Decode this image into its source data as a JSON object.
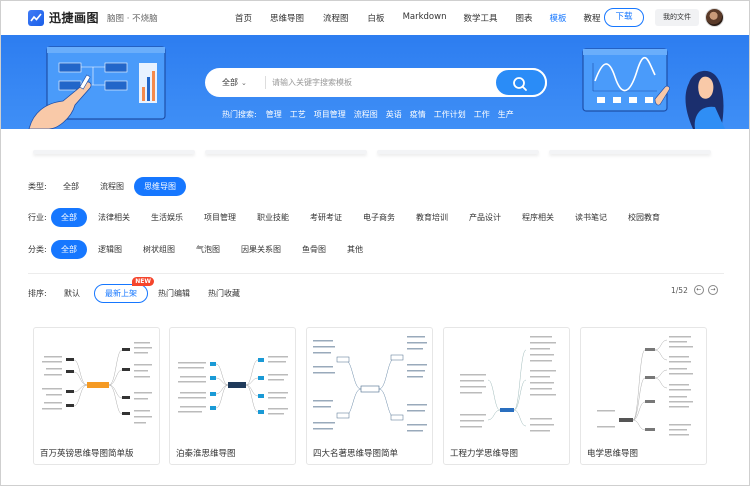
{
  "header": {
    "logo_text": "迅捷画图",
    "logo_sub": "脑图 · 不烧脑",
    "nav": [
      "首页",
      "思维导图",
      "流程图",
      "白板",
      "Markdown",
      "数学工具",
      "图表",
      "模板",
      "教程"
    ],
    "nav_active": "模板",
    "download_label": "下载",
    "my_files_label": "我的文件",
    "accent_color": "#1677ff"
  },
  "search": {
    "category": "全部",
    "placeholder": "请输入关键字搜索模板",
    "hot_label": "热门搜索:",
    "hot_terms": [
      "管理",
      "工艺",
      "项目管理",
      "流程图",
      "英语",
      "疫情",
      "工作计划",
      "工作",
      "生产"
    ]
  },
  "filters": {
    "type": {
      "label": "类型:",
      "options": [
        "全部",
        "流程图",
        "思维导图"
      ],
      "selected": "思维导图"
    },
    "industry": {
      "label": "行业:",
      "options": [
        "全部",
        "法律相关",
        "生活娱乐",
        "项目管理",
        "职业技能",
        "考研考证",
        "电子商务",
        "教育培训",
        "产品设计",
        "程序相关",
        "读书笔记",
        "校园教育"
      ],
      "selected": "全部"
    },
    "category": {
      "label": "分类:",
      "options": [
        "全部",
        "逻辑图",
        "树状组图",
        "气泡图",
        "因果关系图",
        "鱼骨图",
        "其他"
      ],
      "selected": "全部"
    }
  },
  "sort": {
    "label": "排序:",
    "default": "默认",
    "newest": "最新上架",
    "new_badge": "NEW",
    "hot_edit": "热门编辑",
    "hot_fav": "热门收藏",
    "page": "1/52"
  },
  "cards": [
    {
      "title": "百万英镑思维导图简单版"
    },
    {
      "title": "泊秦淮思维导图"
    },
    {
      "title": "四大名著思维导图简单"
    },
    {
      "title": "工程力学思维导图"
    },
    {
      "title": "电学思维导图"
    }
  ]
}
